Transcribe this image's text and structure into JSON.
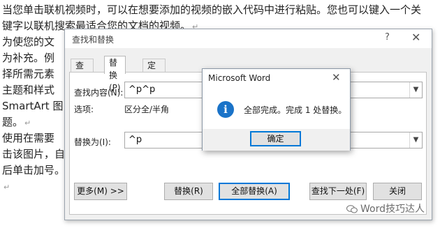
{
  "document": {
    "lines": [
      "当您单击联机视频时，可以在想要添加的视频的嵌入代码中进行粘贴。您也可以键入一个关",
      "键字以联机搜索最适合您的文档的视频。",
      "为使您的文",
      "为补充。例",
      "择所需元素",
      "主题和样式",
      "SmartArt 图",
      "题。",
      "使用在需要",
      "击该图片，自",
      "后单击加号。"
    ],
    "paragraph_mark": "↵"
  },
  "find_replace_dialog": {
    "title": "查找和替换",
    "help": "?",
    "close": "✕",
    "tabs": [
      {
        "label": "查找(D)",
        "active": false
      },
      {
        "label": "替换(P)",
        "active": true
      },
      {
        "label": "定位(G)",
        "active": false
      }
    ],
    "find_label": "查找内容(N):",
    "find_value": "^p^p",
    "options_label": "选项:",
    "options_value": "区分全/半角",
    "replace_label": "替换为(I):",
    "replace_value": "^p",
    "buttons": {
      "more": "更多(M) >>",
      "replace": "替换(R)",
      "replace_all": "全部替换(A)",
      "find_next": "查找下一处(F)",
      "close": "关闭"
    }
  },
  "message_box": {
    "title": "Microsoft Word",
    "close": "✕",
    "icon": "info-icon",
    "message": "全部完成。完成 1 处替换。",
    "ok_label": "确定"
  },
  "watermark": {
    "text": "Word技巧达人",
    "icon": "wechat-icon"
  },
  "colors": {
    "accent": "#0078d7",
    "info_icon": "#1a73c8"
  }
}
